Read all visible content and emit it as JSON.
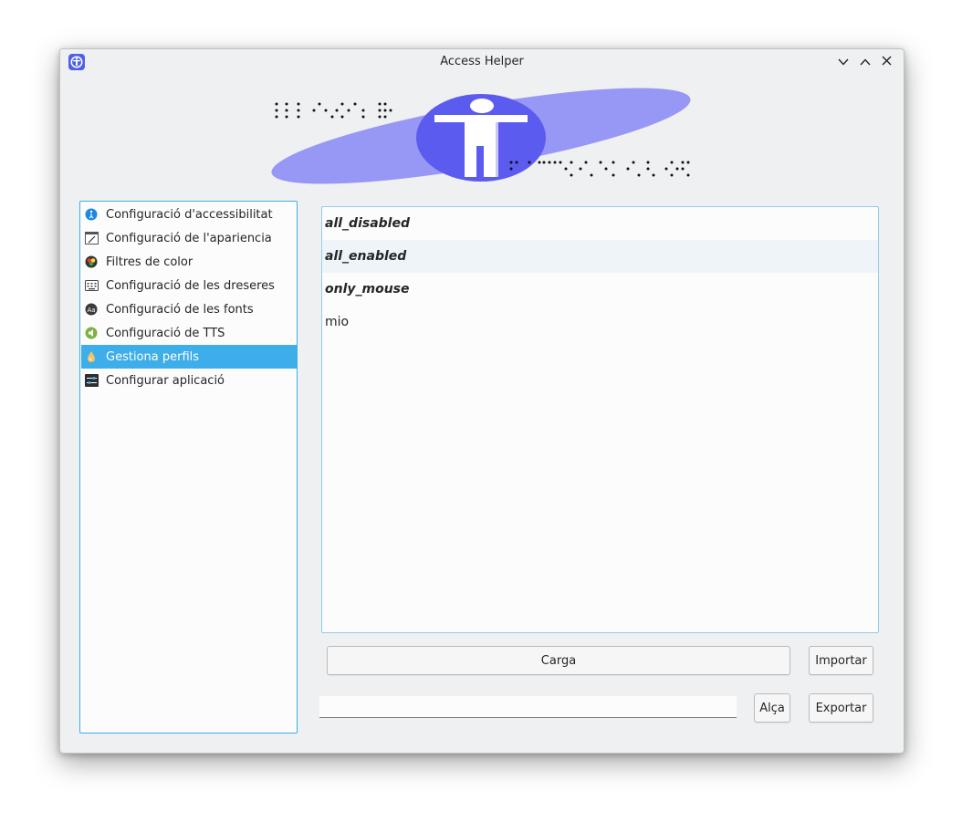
{
  "window": {
    "title": "Access Helper"
  },
  "titlebar": {
    "app_icon": "accessibility-icon",
    "buttons": [
      "minimize-icon",
      "maximize-icon",
      "close-icon"
    ]
  },
  "banner": {
    "icon": "accessibility-banner-icon"
  },
  "sidebar": {
    "items": [
      {
        "label": "Configuració d'accessibilitat",
        "icon": "accessibility-settings-icon"
      },
      {
        "label": "Configuració de l'apariencia",
        "icon": "appearance-icon"
      },
      {
        "label": "Filtres de color",
        "icon": "color-filter-icon"
      },
      {
        "label": "Configuració de les dreseres",
        "icon": "keyboard-shortcuts-icon"
      },
      {
        "label": "Configuració de les fonts",
        "icon": "fonts-icon"
      },
      {
        "label": "Configuració de TTS",
        "icon": "tts-icon"
      },
      {
        "label": "Gestiona perfils",
        "icon": "profiles-icon",
        "selected": true
      },
      {
        "label": "Configurar aplicació",
        "icon": "app-config-icon"
      }
    ]
  },
  "profiles": {
    "items": [
      {
        "label": "all_disabled"
      },
      {
        "label": "all_enabled"
      },
      {
        "label": "only_mouse"
      },
      {
        "label": "mio"
      }
    ]
  },
  "actions": {
    "load_label": "Carga",
    "import_label": "Importar",
    "save_label": "Alça",
    "export_label": "Exportar",
    "name_value": ""
  },
  "colors": {
    "accent": "#3daee9",
    "banner_ellipse": "#9797f6",
    "banner_circle": "#5b5bf0"
  }
}
